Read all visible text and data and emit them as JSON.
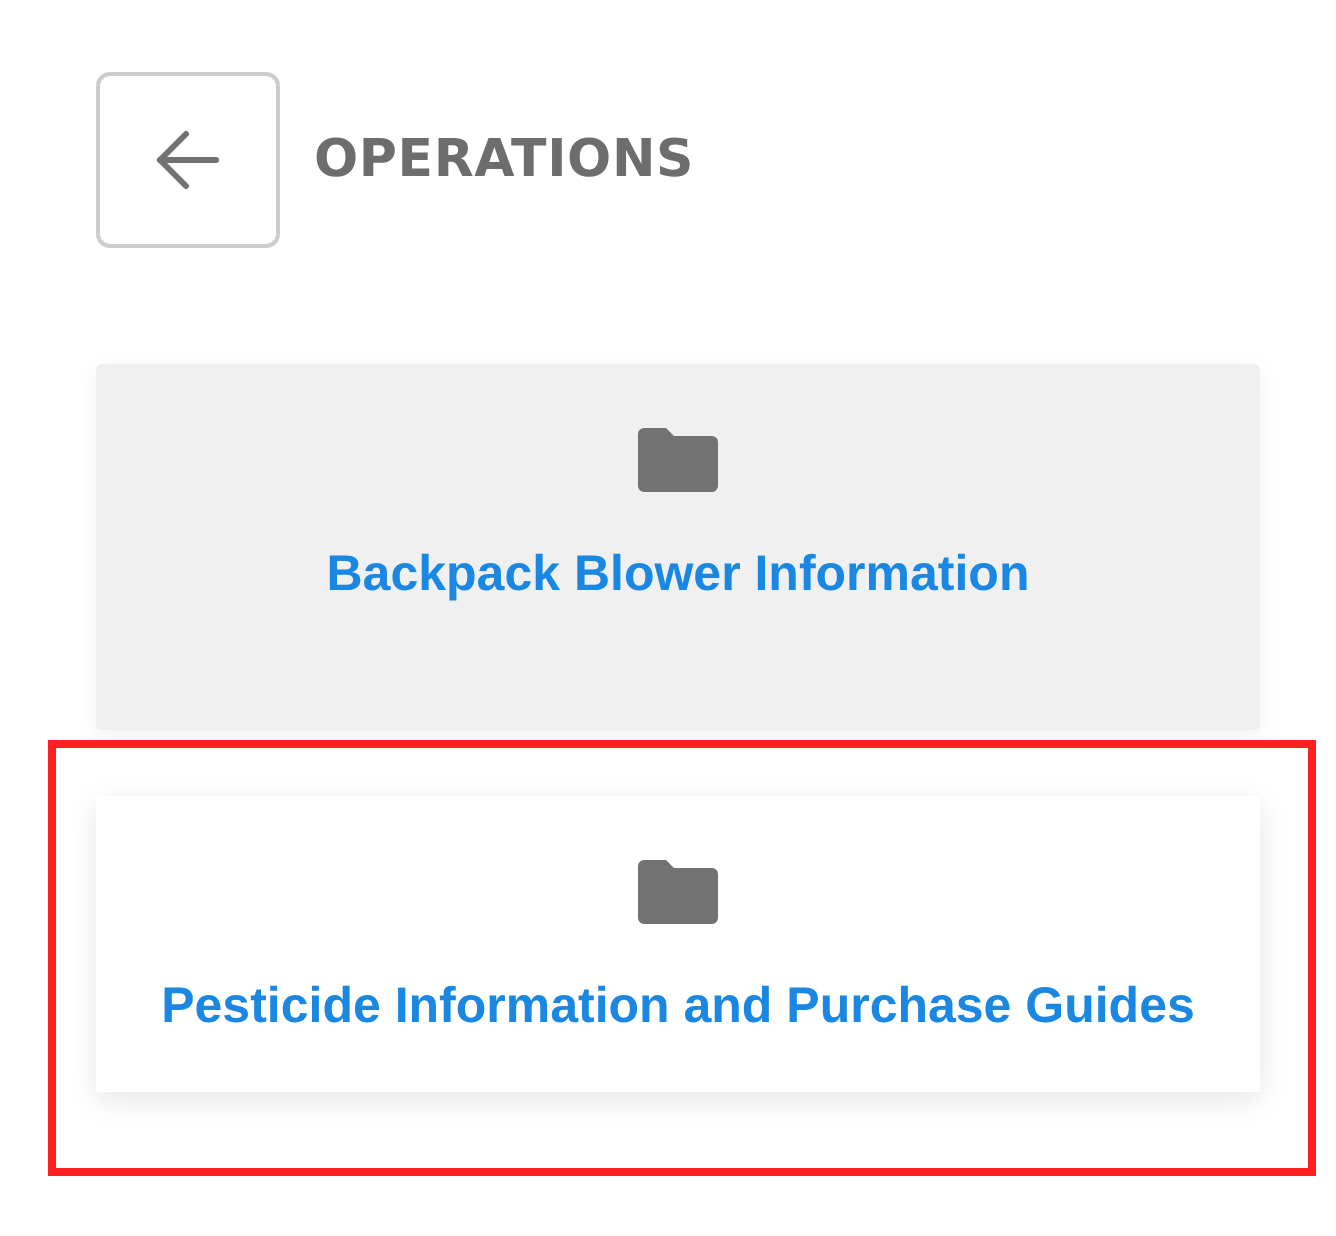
{
  "header": {
    "title": "OPERATIONS"
  },
  "cards": [
    {
      "kind": "folder",
      "label": "Backpack Blower Information",
      "hovered": true,
      "highlighted": false
    },
    {
      "kind": "folder",
      "label": "Pesticide Information and Purchase Guides",
      "hovered": false,
      "highlighted": true
    }
  ]
}
